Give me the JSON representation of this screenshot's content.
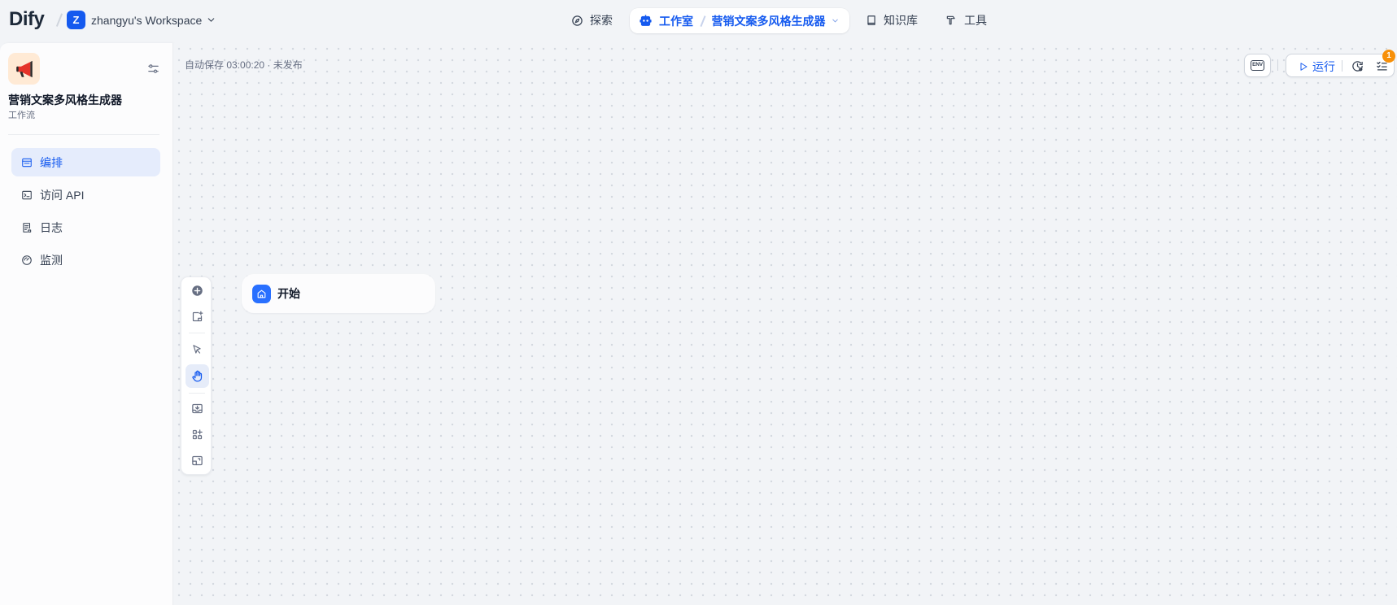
{
  "colors": {
    "accent": "#155aef",
    "canvas_bg": "#f2f4f7",
    "active_nav_bg": "#e5ecfc",
    "badge": "#f79009",
    "app_icon_bg": "#ffead5",
    "start_node_icon_bg": "#2970ff"
  },
  "header": {
    "logo": "Dify",
    "workspace": {
      "initial": "Z",
      "name": "zhangyu's Workspace"
    },
    "nav": {
      "explore": {
        "label": "探索",
        "icon": "compass-icon"
      },
      "studio": {
        "label": "工作室",
        "icon": "robot-icon",
        "current_app": "营销文案多风格生成器"
      },
      "knowledge": {
        "label": "知识库",
        "icon": "book-icon"
      },
      "tools": {
        "label": "工具",
        "icon": "hammer-icon"
      }
    }
  },
  "sidebar": {
    "app": {
      "icon": "megaphone-icon",
      "name": "营销文案多风格生成器",
      "mode": "工作流"
    },
    "items": [
      {
        "label": "编排",
        "icon": "layout-icon",
        "active": true
      },
      {
        "label": "访问 API",
        "icon": "terminal-icon",
        "active": false
      },
      {
        "label": "日志",
        "icon": "file-list-icon",
        "active": false
      },
      {
        "label": "监测",
        "icon": "dashboard-icon",
        "active": false
      }
    ]
  },
  "canvas": {
    "autosave_status": "自动保存 03:00:20 · 未发布",
    "env_label": "ENV",
    "run_label": "运行",
    "checklist_count": "1",
    "toolbar": {
      "tools": [
        "plus-circle-icon",
        "note-add-icon",
        "cursor-icon",
        "hand-icon",
        "image-export-icon",
        "organize-icon",
        "minimap-icon"
      ],
      "active_tool": "hand-icon"
    },
    "nodes": [
      {
        "title": "开始",
        "icon": "home-icon"
      }
    ]
  }
}
